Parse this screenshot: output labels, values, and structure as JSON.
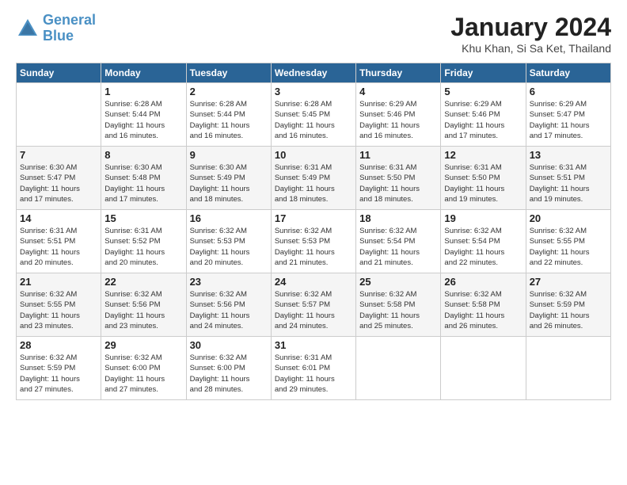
{
  "header": {
    "logo_line1": "General",
    "logo_line2": "Blue",
    "month_title": "January 2024",
    "location": "Khu Khan, Si Sa Ket, Thailand"
  },
  "days_of_week": [
    "Sunday",
    "Monday",
    "Tuesday",
    "Wednesday",
    "Thursday",
    "Friday",
    "Saturday"
  ],
  "weeks": [
    [
      {
        "day": "",
        "info": ""
      },
      {
        "day": "1",
        "info": "Sunrise: 6:28 AM\nSunset: 5:44 PM\nDaylight: 11 hours\nand 16 minutes."
      },
      {
        "day": "2",
        "info": "Sunrise: 6:28 AM\nSunset: 5:44 PM\nDaylight: 11 hours\nand 16 minutes."
      },
      {
        "day": "3",
        "info": "Sunrise: 6:28 AM\nSunset: 5:45 PM\nDaylight: 11 hours\nand 16 minutes."
      },
      {
        "day": "4",
        "info": "Sunrise: 6:29 AM\nSunset: 5:46 PM\nDaylight: 11 hours\nand 16 minutes."
      },
      {
        "day": "5",
        "info": "Sunrise: 6:29 AM\nSunset: 5:46 PM\nDaylight: 11 hours\nand 17 minutes."
      },
      {
        "day": "6",
        "info": "Sunrise: 6:29 AM\nSunset: 5:47 PM\nDaylight: 11 hours\nand 17 minutes."
      }
    ],
    [
      {
        "day": "7",
        "info": "Sunrise: 6:30 AM\nSunset: 5:47 PM\nDaylight: 11 hours\nand 17 minutes."
      },
      {
        "day": "8",
        "info": "Sunrise: 6:30 AM\nSunset: 5:48 PM\nDaylight: 11 hours\nand 17 minutes."
      },
      {
        "day": "9",
        "info": "Sunrise: 6:30 AM\nSunset: 5:49 PM\nDaylight: 11 hours\nand 18 minutes."
      },
      {
        "day": "10",
        "info": "Sunrise: 6:31 AM\nSunset: 5:49 PM\nDaylight: 11 hours\nand 18 minutes."
      },
      {
        "day": "11",
        "info": "Sunrise: 6:31 AM\nSunset: 5:50 PM\nDaylight: 11 hours\nand 18 minutes."
      },
      {
        "day": "12",
        "info": "Sunrise: 6:31 AM\nSunset: 5:50 PM\nDaylight: 11 hours\nand 19 minutes."
      },
      {
        "day": "13",
        "info": "Sunrise: 6:31 AM\nSunset: 5:51 PM\nDaylight: 11 hours\nand 19 minutes."
      }
    ],
    [
      {
        "day": "14",
        "info": "Sunrise: 6:31 AM\nSunset: 5:51 PM\nDaylight: 11 hours\nand 20 minutes."
      },
      {
        "day": "15",
        "info": "Sunrise: 6:31 AM\nSunset: 5:52 PM\nDaylight: 11 hours\nand 20 minutes."
      },
      {
        "day": "16",
        "info": "Sunrise: 6:32 AM\nSunset: 5:53 PM\nDaylight: 11 hours\nand 20 minutes."
      },
      {
        "day": "17",
        "info": "Sunrise: 6:32 AM\nSunset: 5:53 PM\nDaylight: 11 hours\nand 21 minutes."
      },
      {
        "day": "18",
        "info": "Sunrise: 6:32 AM\nSunset: 5:54 PM\nDaylight: 11 hours\nand 21 minutes."
      },
      {
        "day": "19",
        "info": "Sunrise: 6:32 AM\nSunset: 5:54 PM\nDaylight: 11 hours\nand 22 minutes."
      },
      {
        "day": "20",
        "info": "Sunrise: 6:32 AM\nSunset: 5:55 PM\nDaylight: 11 hours\nand 22 minutes."
      }
    ],
    [
      {
        "day": "21",
        "info": "Sunrise: 6:32 AM\nSunset: 5:55 PM\nDaylight: 11 hours\nand 23 minutes."
      },
      {
        "day": "22",
        "info": "Sunrise: 6:32 AM\nSunset: 5:56 PM\nDaylight: 11 hours\nand 23 minutes."
      },
      {
        "day": "23",
        "info": "Sunrise: 6:32 AM\nSunset: 5:56 PM\nDaylight: 11 hours\nand 24 minutes."
      },
      {
        "day": "24",
        "info": "Sunrise: 6:32 AM\nSunset: 5:57 PM\nDaylight: 11 hours\nand 24 minutes."
      },
      {
        "day": "25",
        "info": "Sunrise: 6:32 AM\nSunset: 5:58 PM\nDaylight: 11 hours\nand 25 minutes."
      },
      {
        "day": "26",
        "info": "Sunrise: 6:32 AM\nSunset: 5:58 PM\nDaylight: 11 hours\nand 26 minutes."
      },
      {
        "day": "27",
        "info": "Sunrise: 6:32 AM\nSunset: 5:59 PM\nDaylight: 11 hours\nand 26 minutes."
      }
    ],
    [
      {
        "day": "28",
        "info": "Sunrise: 6:32 AM\nSunset: 5:59 PM\nDaylight: 11 hours\nand 27 minutes."
      },
      {
        "day": "29",
        "info": "Sunrise: 6:32 AM\nSunset: 6:00 PM\nDaylight: 11 hours\nand 27 minutes."
      },
      {
        "day": "30",
        "info": "Sunrise: 6:32 AM\nSunset: 6:00 PM\nDaylight: 11 hours\nand 28 minutes."
      },
      {
        "day": "31",
        "info": "Sunrise: 6:31 AM\nSunset: 6:01 PM\nDaylight: 11 hours\nand 29 minutes."
      },
      {
        "day": "",
        "info": ""
      },
      {
        "day": "",
        "info": ""
      },
      {
        "day": "",
        "info": ""
      }
    ]
  ]
}
